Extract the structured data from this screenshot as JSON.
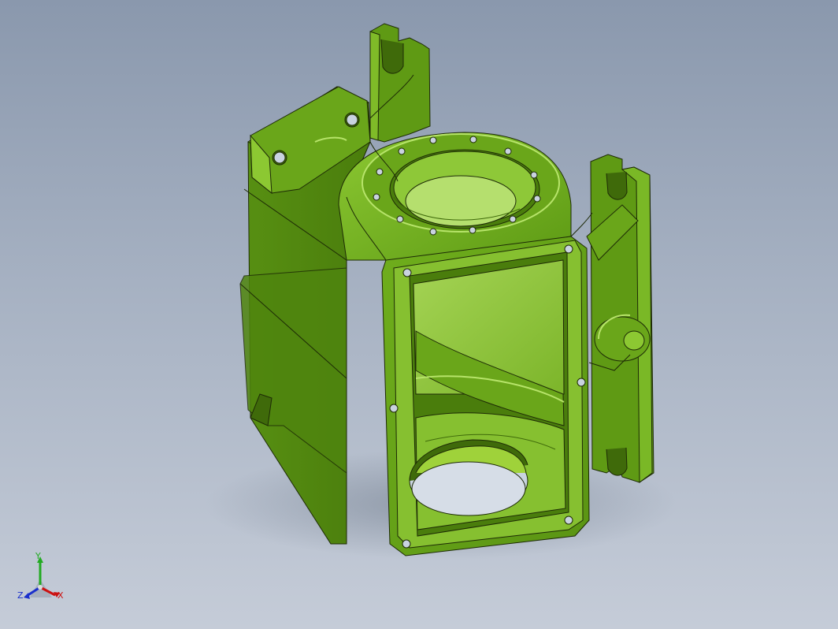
{
  "viewport": {
    "background_top": "#8a98ad",
    "background_bottom": "#c5ccd8"
  },
  "model": {
    "color": "#5f9a14",
    "highlight": "#9fd23a",
    "shadow": "#3f6a0a",
    "edge_color": "#1d2a06"
  },
  "triad": {
    "x_label": "X",
    "y_label": "Y",
    "z_label": "Z",
    "x_color": "#cc1111",
    "y_color": "#22aa22",
    "z_color": "#1a2fcc"
  }
}
